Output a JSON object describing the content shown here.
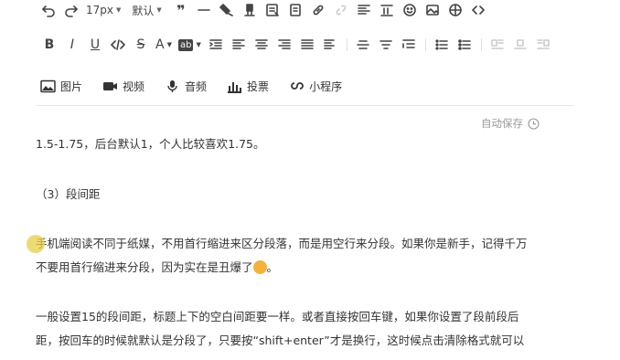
{
  "toolbar": {
    "font_size": "17px",
    "font_family": "默认",
    "quote_glyph": "❞",
    "bold": "B",
    "italic": "I",
    "underline": "U",
    "strike": "S",
    "font_color": "A",
    "bg_color": "ab"
  },
  "insert": {
    "image": "图片",
    "video": "视频",
    "audio": "音频",
    "vote": "投票",
    "miniprogram": "小程序"
  },
  "status": {
    "autosave": "自动保存"
  },
  "content": {
    "p1": "1.5-1.75，后台默认1，个人比较喜欢1.75。",
    "p2": "（3）段间距",
    "p3_line1": "手机端阅读不同于纸媒，不用首行缩进来区分段落，而是用空行来分段。如果你是新手，记得千万",
    "p3_line2": "不要用首行缩进来分段，因为实在是丑爆了",
    "p3_end": "。",
    "p4_line1": "一般设置15的段间距，标题上下的空白间距要一样。或者直接按回车键，如果你设置了段前段后",
    "p4_line2": "距，按回车的时候就默认是分段了，只要按“shift+enter”才是换行，这时候点击清除格式就可以"
  },
  "colors": {
    "accent": "#e8ce46",
    "text": "#333333",
    "muted": "#999999"
  }
}
